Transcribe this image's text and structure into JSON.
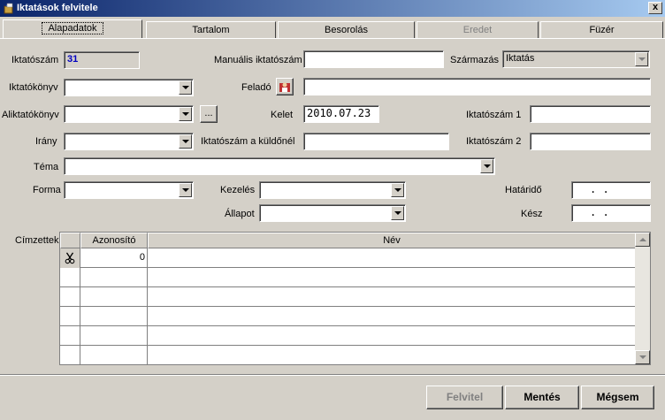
{
  "window": {
    "title": "Iktatások felvitele",
    "close": "x"
  },
  "tabs": [
    {
      "label": "Alapadatok",
      "active": true
    },
    {
      "label": "Tartalom"
    },
    {
      "label": "Besorolás"
    },
    {
      "label": "Eredet",
      "disabled": true
    },
    {
      "label": "Füzér"
    }
  ],
  "form": {
    "iktatoszam_label": "Iktatószám",
    "iktatoszam_value": "31",
    "manualis_label": "Manuális iktatószám",
    "manualis_value": "",
    "szarmazas_label": "Származás",
    "szarmazas_value": "Iktatás",
    "iktatokonyv_label": "Iktatókönyv",
    "iktatokonyv_value": "",
    "felado_label": "Feladó",
    "felado_value": "",
    "aliktatokonyv_label": "Aliktatókönyv",
    "aliktatokonyv_value": "",
    "ellipsis_label": "...",
    "kelet_label": "Kelet",
    "kelet_value": "2010.07.23",
    "iktatoszam1_label": "Iktatószám 1",
    "iktatoszam1_value": "",
    "irany_label": "Irány",
    "irany_value": "",
    "iktatoszam_kuldonel_label": "Iktatószám a küldőnél",
    "iktatoszam_kuldonel_value": "",
    "iktatoszam2_label": "Iktatószám 2",
    "iktatoszam2_value": "",
    "tema_label": "Téma",
    "tema_value": "",
    "forma_label": "Forma",
    "forma_value": "",
    "kezeles_label": "Kezelés",
    "kezeles_value": "",
    "hatarido_label": "Határidő",
    "hatarido_value": " .  .",
    "allapot_label": "Állapot",
    "allapot_value": "",
    "kesz_label": "Kész",
    "kesz_value": " .  ."
  },
  "recipients": {
    "label": "Címzettek",
    "columns": [
      "",
      "Azonosító",
      "Név"
    ],
    "rows": [
      {
        "icon": "scissors-icon",
        "azonosito": "0",
        "nev": ""
      },
      {
        "azonosito": "",
        "nev": ""
      },
      {
        "azonosito": "",
        "nev": ""
      },
      {
        "azonosito": "",
        "nev": ""
      },
      {
        "azonosito": "",
        "nev": ""
      },
      {
        "azonosito": "",
        "nev": ""
      }
    ]
  },
  "buttons": {
    "felvitel": "Felvitel",
    "mentes": "Mentés",
    "megsem": "Mégsem"
  },
  "colors": {
    "titlebar_start": "#0a246a",
    "titlebar_end": "#a6caf0",
    "face": "#d4d0c8",
    "iktatoszam": "#0000c0"
  }
}
